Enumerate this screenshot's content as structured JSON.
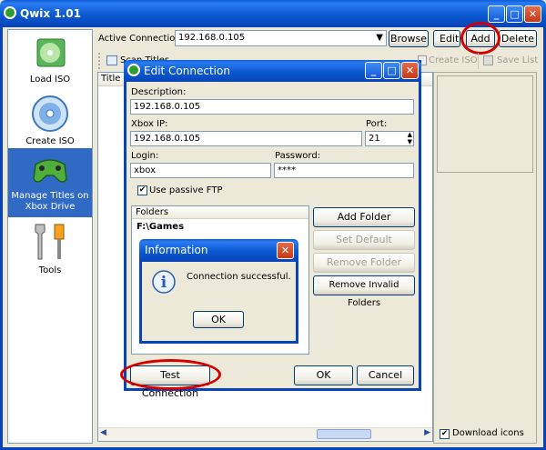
{
  "window": {
    "title": "Qwix 1.01"
  },
  "sidebar": {
    "items": [
      {
        "label": "Load ISO",
        "icon": "disc-stack-icon"
      },
      {
        "label": "Create ISO",
        "icon": "disc-icon"
      },
      {
        "label": "Manage Titles on Xbox Drive",
        "icon": "gamepad-icon"
      },
      {
        "label": "Tools",
        "icon": "wrench-icon"
      }
    ]
  },
  "toolbar": {
    "active_connection_label": "Active Connection:",
    "connection_value": "192.168.0.105",
    "browse": "Browse",
    "edit": "Edit",
    "add": "Add",
    "delete": "Delete"
  },
  "subtoolbar": {
    "scan_titles": "Scan Titles",
    "create_iso": "Create ISO",
    "save_list": "Save List"
  },
  "list": {
    "col_title": "Title"
  },
  "footer": {
    "download_icons": "Download icons"
  },
  "edit_dialog": {
    "title": "Edit Connection",
    "description_label": "Description:",
    "description_value": "192.168.0.105",
    "xbox_ip_label": "Xbox IP:",
    "xbox_ip_value": "192.168.0.105",
    "port_label": "Port:",
    "port_value": "21",
    "login_label": "Login:",
    "login_value": "xbox",
    "password_label": "Password:",
    "password_value": "****",
    "passive_ftp": "Use passive FTP",
    "folders_header": "Folders",
    "folders": [
      "F:\\Games"
    ],
    "add_folder": "Add Folder",
    "set_default": "Set Default",
    "remove_folder": "Remove Folder",
    "remove_invalid": "Remove Invalid Folders",
    "test_connection": "Test Connection",
    "ok": "OK",
    "cancel": "Cancel"
  },
  "info_dialog": {
    "title": "Information",
    "message": "Connection successful.",
    "ok": "OK"
  },
  "colors": {
    "xp_blue": "#0a59d0",
    "highlight": "#d40000",
    "selected": "#316ac5"
  }
}
